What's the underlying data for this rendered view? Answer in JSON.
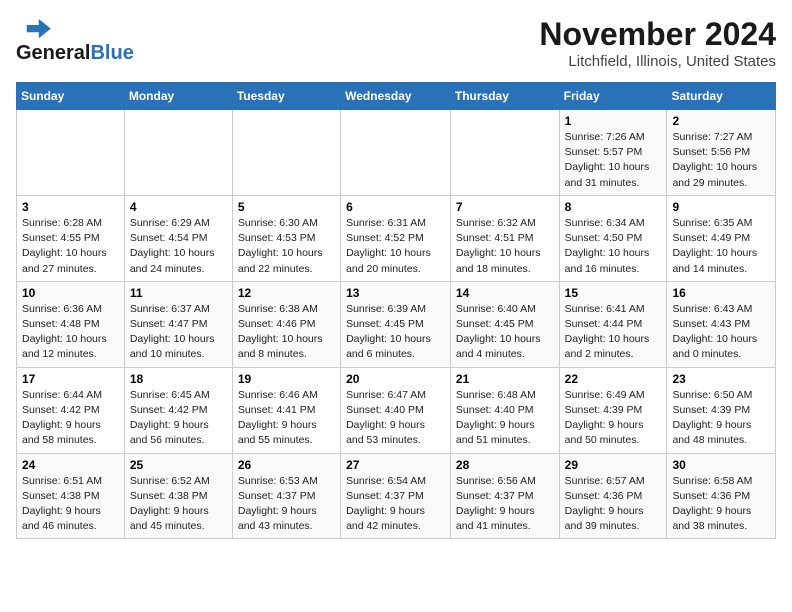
{
  "logo": {
    "text_general": "General",
    "text_blue": "Blue"
  },
  "title": "November 2024",
  "subtitle": "Litchfield, Illinois, United States",
  "header_row": [
    "Sunday",
    "Monday",
    "Tuesday",
    "Wednesday",
    "Thursday",
    "Friday",
    "Saturday"
  ],
  "weeks": [
    [
      {
        "num": "",
        "info": ""
      },
      {
        "num": "",
        "info": ""
      },
      {
        "num": "",
        "info": ""
      },
      {
        "num": "",
        "info": ""
      },
      {
        "num": "",
        "info": ""
      },
      {
        "num": "1",
        "info": "Sunrise: 7:26 AM\nSunset: 5:57 PM\nDaylight: 10 hours\nand 31 minutes."
      },
      {
        "num": "2",
        "info": "Sunrise: 7:27 AM\nSunset: 5:56 PM\nDaylight: 10 hours\nand 29 minutes."
      }
    ],
    [
      {
        "num": "3",
        "info": "Sunrise: 6:28 AM\nSunset: 4:55 PM\nDaylight: 10 hours\nand 27 minutes."
      },
      {
        "num": "4",
        "info": "Sunrise: 6:29 AM\nSunset: 4:54 PM\nDaylight: 10 hours\nand 24 minutes."
      },
      {
        "num": "5",
        "info": "Sunrise: 6:30 AM\nSunset: 4:53 PM\nDaylight: 10 hours\nand 22 minutes."
      },
      {
        "num": "6",
        "info": "Sunrise: 6:31 AM\nSunset: 4:52 PM\nDaylight: 10 hours\nand 20 minutes."
      },
      {
        "num": "7",
        "info": "Sunrise: 6:32 AM\nSunset: 4:51 PM\nDaylight: 10 hours\nand 18 minutes."
      },
      {
        "num": "8",
        "info": "Sunrise: 6:34 AM\nSunset: 4:50 PM\nDaylight: 10 hours\nand 16 minutes."
      },
      {
        "num": "9",
        "info": "Sunrise: 6:35 AM\nSunset: 4:49 PM\nDaylight: 10 hours\nand 14 minutes."
      }
    ],
    [
      {
        "num": "10",
        "info": "Sunrise: 6:36 AM\nSunset: 4:48 PM\nDaylight: 10 hours\nand 12 minutes."
      },
      {
        "num": "11",
        "info": "Sunrise: 6:37 AM\nSunset: 4:47 PM\nDaylight: 10 hours\nand 10 minutes."
      },
      {
        "num": "12",
        "info": "Sunrise: 6:38 AM\nSunset: 4:46 PM\nDaylight: 10 hours\nand 8 minutes."
      },
      {
        "num": "13",
        "info": "Sunrise: 6:39 AM\nSunset: 4:45 PM\nDaylight: 10 hours\nand 6 minutes."
      },
      {
        "num": "14",
        "info": "Sunrise: 6:40 AM\nSunset: 4:45 PM\nDaylight: 10 hours\nand 4 minutes."
      },
      {
        "num": "15",
        "info": "Sunrise: 6:41 AM\nSunset: 4:44 PM\nDaylight: 10 hours\nand 2 minutes."
      },
      {
        "num": "16",
        "info": "Sunrise: 6:43 AM\nSunset: 4:43 PM\nDaylight: 10 hours\nand 0 minutes."
      }
    ],
    [
      {
        "num": "17",
        "info": "Sunrise: 6:44 AM\nSunset: 4:42 PM\nDaylight: 9 hours\nand 58 minutes."
      },
      {
        "num": "18",
        "info": "Sunrise: 6:45 AM\nSunset: 4:42 PM\nDaylight: 9 hours\nand 56 minutes."
      },
      {
        "num": "19",
        "info": "Sunrise: 6:46 AM\nSunset: 4:41 PM\nDaylight: 9 hours\nand 55 minutes."
      },
      {
        "num": "20",
        "info": "Sunrise: 6:47 AM\nSunset: 4:40 PM\nDaylight: 9 hours\nand 53 minutes."
      },
      {
        "num": "21",
        "info": "Sunrise: 6:48 AM\nSunset: 4:40 PM\nDaylight: 9 hours\nand 51 minutes."
      },
      {
        "num": "22",
        "info": "Sunrise: 6:49 AM\nSunset: 4:39 PM\nDaylight: 9 hours\nand 50 minutes."
      },
      {
        "num": "23",
        "info": "Sunrise: 6:50 AM\nSunset: 4:39 PM\nDaylight: 9 hours\nand 48 minutes."
      }
    ],
    [
      {
        "num": "24",
        "info": "Sunrise: 6:51 AM\nSunset: 4:38 PM\nDaylight: 9 hours\nand 46 minutes."
      },
      {
        "num": "25",
        "info": "Sunrise: 6:52 AM\nSunset: 4:38 PM\nDaylight: 9 hours\nand 45 minutes."
      },
      {
        "num": "26",
        "info": "Sunrise: 6:53 AM\nSunset: 4:37 PM\nDaylight: 9 hours\nand 43 minutes."
      },
      {
        "num": "27",
        "info": "Sunrise: 6:54 AM\nSunset: 4:37 PM\nDaylight: 9 hours\nand 42 minutes."
      },
      {
        "num": "28",
        "info": "Sunrise: 6:56 AM\nSunset: 4:37 PM\nDaylight: 9 hours\nand 41 minutes."
      },
      {
        "num": "29",
        "info": "Sunrise: 6:57 AM\nSunset: 4:36 PM\nDaylight: 9 hours\nand 39 minutes."
      },
      {
        "num": "30",
        "info": "Sunrise: 6:58 AM\nSunset: 4:36 PM\nDaylight: 9 hours\nand 38 minutes."
      }
    ]
  ]
}
